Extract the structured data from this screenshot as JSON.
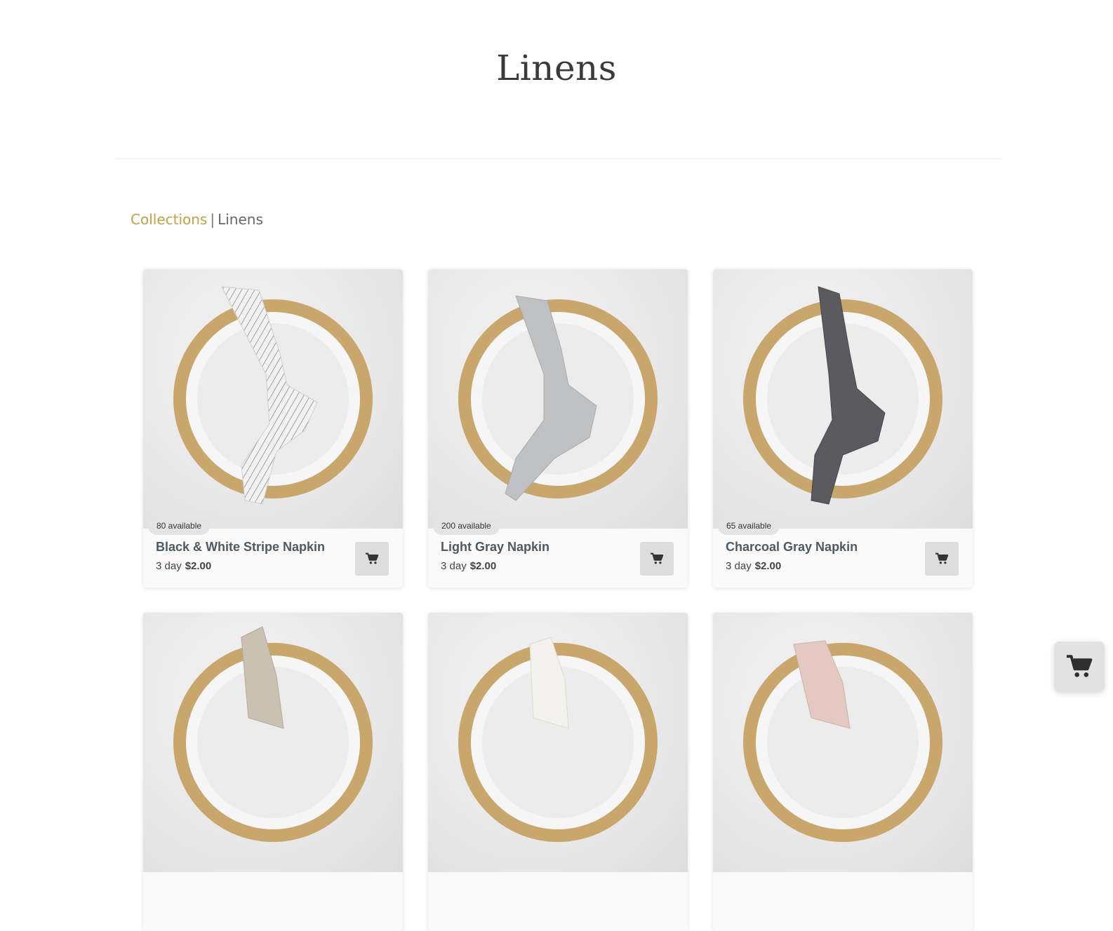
{
  "page": {
    "title": "Linens"
  },
  "breadcrumb": {
    "parent": "Collections",
    "separator": "|",
    "current": "Linens"
  },
  "products": [
    {
      "name": "Black & White Stripe Napkin",
      "availability": "80 available",
      "duration": "3 day",
      "price": "$2.00",
      "napkin_color": "#f1f1f1",
      "striped": true
    },
    {
      "name": "Light Gray Napkin",
      "availability": "200 available",
      "duration": "3 day",
      "price": "$2.00",
      "napkin_color": "#bfc1c3",
      "striped": false
    },
    {
      "name": "Charcoal Gray Napkin",
      "availability": "65 available",
      "duration": "3 day",
      "price": "$2.00",
      "napkin_color": "#5b5a5e",
      "striped": false
    },
    {
      "name": "",
      "availability": "",
      "duration": "",
      "price": "",
      "napkin_color": "#c9c2b2",
      "striped": false
    },
    {
      "name": "",
      "availability": "",
      "duration": "",
      "price": "",
      "napkin_color": "#f4f2ee",
      "striped": false
    },
    {
      "name": "",
      "availability": "",
      "duration": "",
      "price": "",
      "napkin_color": "#e4c8c2",
      "striped": false
    }
  ],
  "icons": {
    "add_to_cart": "cart-icon",
    "floating_cart": "cart-icon"
  },
  "colors": {
    "accent": "#c2a043",
    "product_name": "#4e5a63",
    "charger_wood": "#c9a66b"
  }
}
